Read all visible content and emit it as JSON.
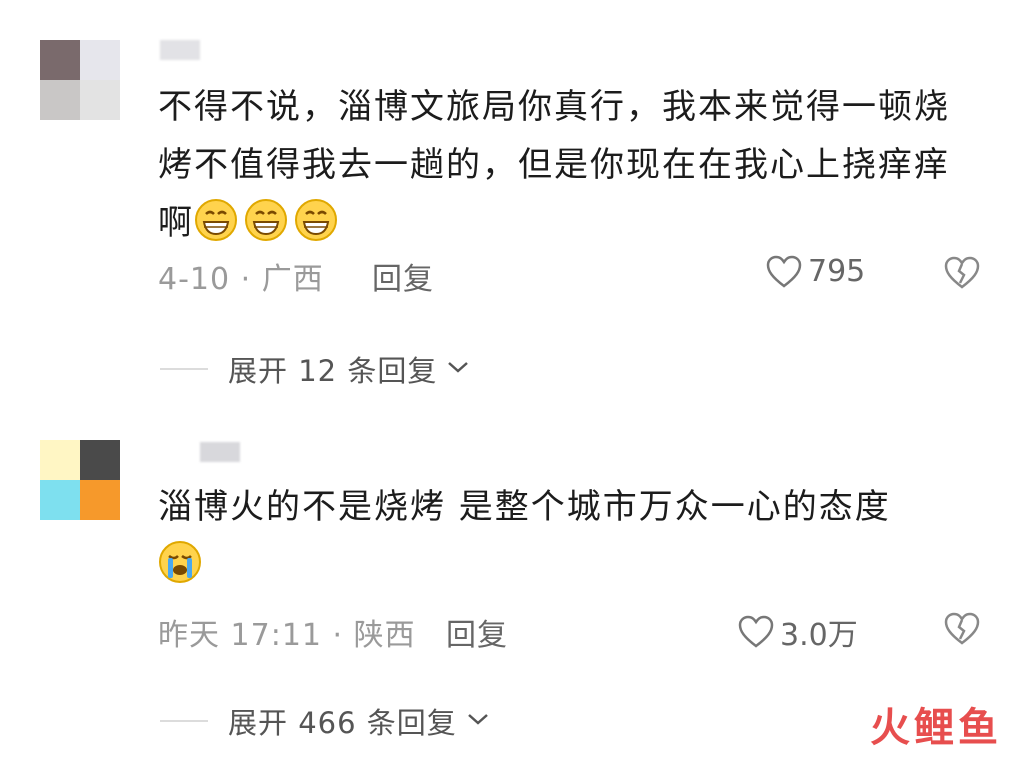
{
  "colors": {
    "avatar1": [
      "#7a6a6c",
      "#e6e6ec",
      "#c9c7c6",
      "#e3e3e3"
    ],
    "avatar2": [
      "#fff6c4",
      "#4a4a4a",
      "#7ee0ef",
      "#f6992b"
    ],
    "brand": "#e53b3b"
  },
  "comments": [
    {
      "text": "不得不说，淄博文旅局你真行，我本来觉得一顿烧烤不值得我去一趟的，但是你现在在我心上挠痒痒啊",
      "emojis": [
        "grin-emoji",
        "grin-emoji",
        "grin-emoji"
      ],
      "meta": "4-10 · 广西",
      "reply_label": "回复",
      "likes": "795",
      "expand_label": "展开 12 条回复"
    },
    {
      "text": "淄博火的不是烧烤  是整个城市万众一心的态度",
      "emojis": [
        "crying-emoji"
      ],
      "meta": "昨天 17:11 · 陕西",
      "reply_label": "回复",
      "likes": "3.0万",
      "expand_label": "展开 466 条回复"
    }
  ],
  "watermark": "火鲤鱼"
}
